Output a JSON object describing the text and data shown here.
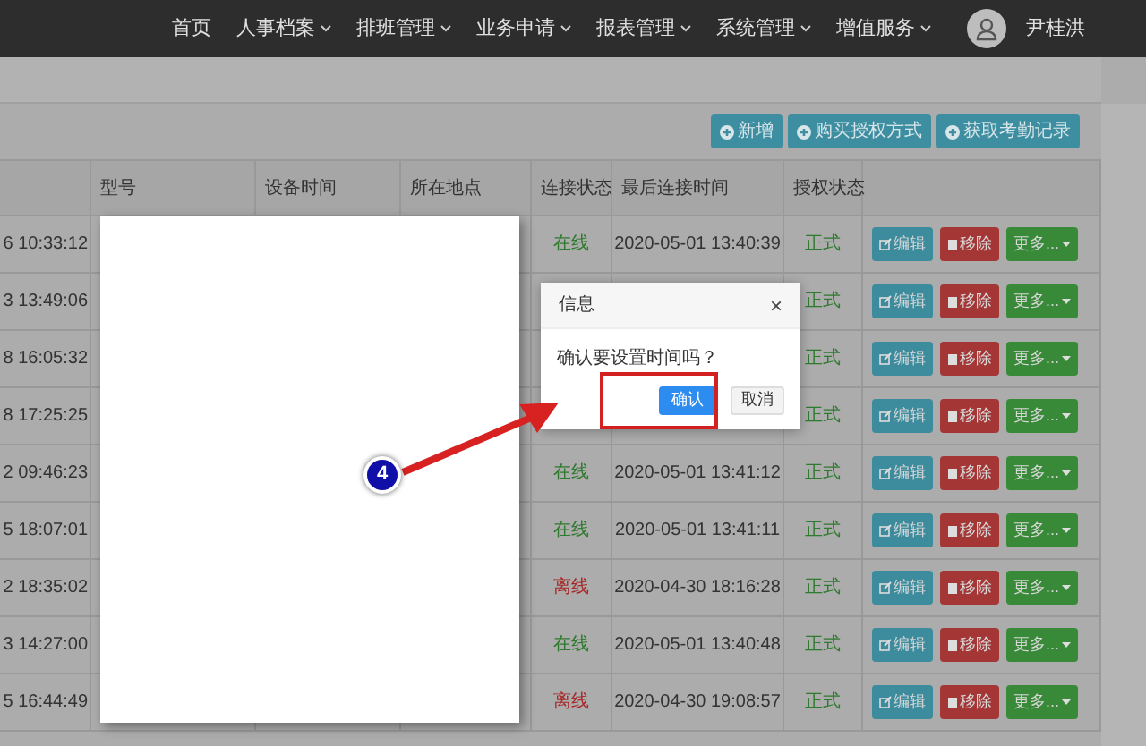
{
  "nav": {
    "items": [
      {
        "label": "首页",
        "dropdown": false
      },
      {
        "label": "人事档案",
        "dropdown": true
      },
      {
        "label": "排班管理",
        "dropdown": true
      },
      {
        "label": "业务申请",
        "dropdown": true
      },
      {
        "label": "报表管理",
        "dropdown": true
      },
      {
        "label": "系统管理",
        "dropdown": true
      },
      {
        "label": "增值服务",
        "dropdown": true
      }
    ],
    "user": "尹桂洪"
  },
  "toolbar": [
    "新增",
    "购买授权方式",
    "获取考勤记录"
  ],
  "table": {
    "columns": [
      "",
      "型号",
      "设备时间",
      "所在地点",
      "连接状态",
      "最后连接时间",
      "授权状态",
      ""
    ],
    "rows": [
      {
        "column_1": "6 10:33:12",
        "status": "在线",
        "online": true,
        "last_time": "2020-05-01 13:40:39",
        "auth": "正式",
        "actions": [
          "编辑",
          "移除",
          "更多..."
        ]
      },
      {
        "column_1": "3 13:49:06",
        "auth": "正式",
        "actions": [
          "编辑",
          "移除",
          "更多..."
        ]
      },
      {
        "column_1": "8 16:05:32",
        "auth": "正式",
        "actions": [
          "编辑",
          "移除",
          "更多..."
        ]
      },
      {
        "column_1": "8 17:25:25",
        "auth": "正式",
        "actions": [
          "编辑",
          "移除",
          "更多..."
        ]
      },
      {
        "column_1": "2 09:46:23",
        "status": "在线",
        "online": true,
        "last_time": "2020-05-01 13:41:12",
        "auth": "正式",
        "actions": [
          "编辑",
          "移除",
          "更多..."
        ]
      },
      {
        "column_1": "5 18:07:01",
        "status": "在线",
        "online": true,
        "last_time": "2020-05-01 13:41:11",
        "auth": "正式",
        "actions": [
          "编辑",
          "移除",
          "更多..."
        ]
      },
      {
        "column_1": "2 18:35:02",
        "status": "离线",
        "online": false,
        "last_time": "2020-04-30 18:16:28",
        "auth": "正式",
        "actions": [
          "编辑",
          "移除",
          "更多..."
        ]
      },
      {
        "column_1": "3 14:27:00",
        "status": "在线",
        "online": true,
        "last_time": "2020-05-01 13:40:48",
        "auth": "正式",
        "actions": [
          "编辑",
          "移除",
          "更多..."
        ]
      },
      {
        "column_1": "5 16:44:49",
        "status": "离线",
        "online": false,
        "last_time": "2020-04-30 19:08:57",
        "auth": "正式",
        "actions": [
          "编辑",
          "移除",
          "更多..."
        ]
      }
    ]
  },
  "dialog": {
    "title": "信息",
    "close": "×",
    "message": "确认要设置时间吗？",
    "buttons": [
      {
        "label": "确认",
        "primary": true
      },
      {
        "label": "取消",
        "primary": false
      }
    ]
  },
  "annotation": {
    "label": "4"
  }
}
